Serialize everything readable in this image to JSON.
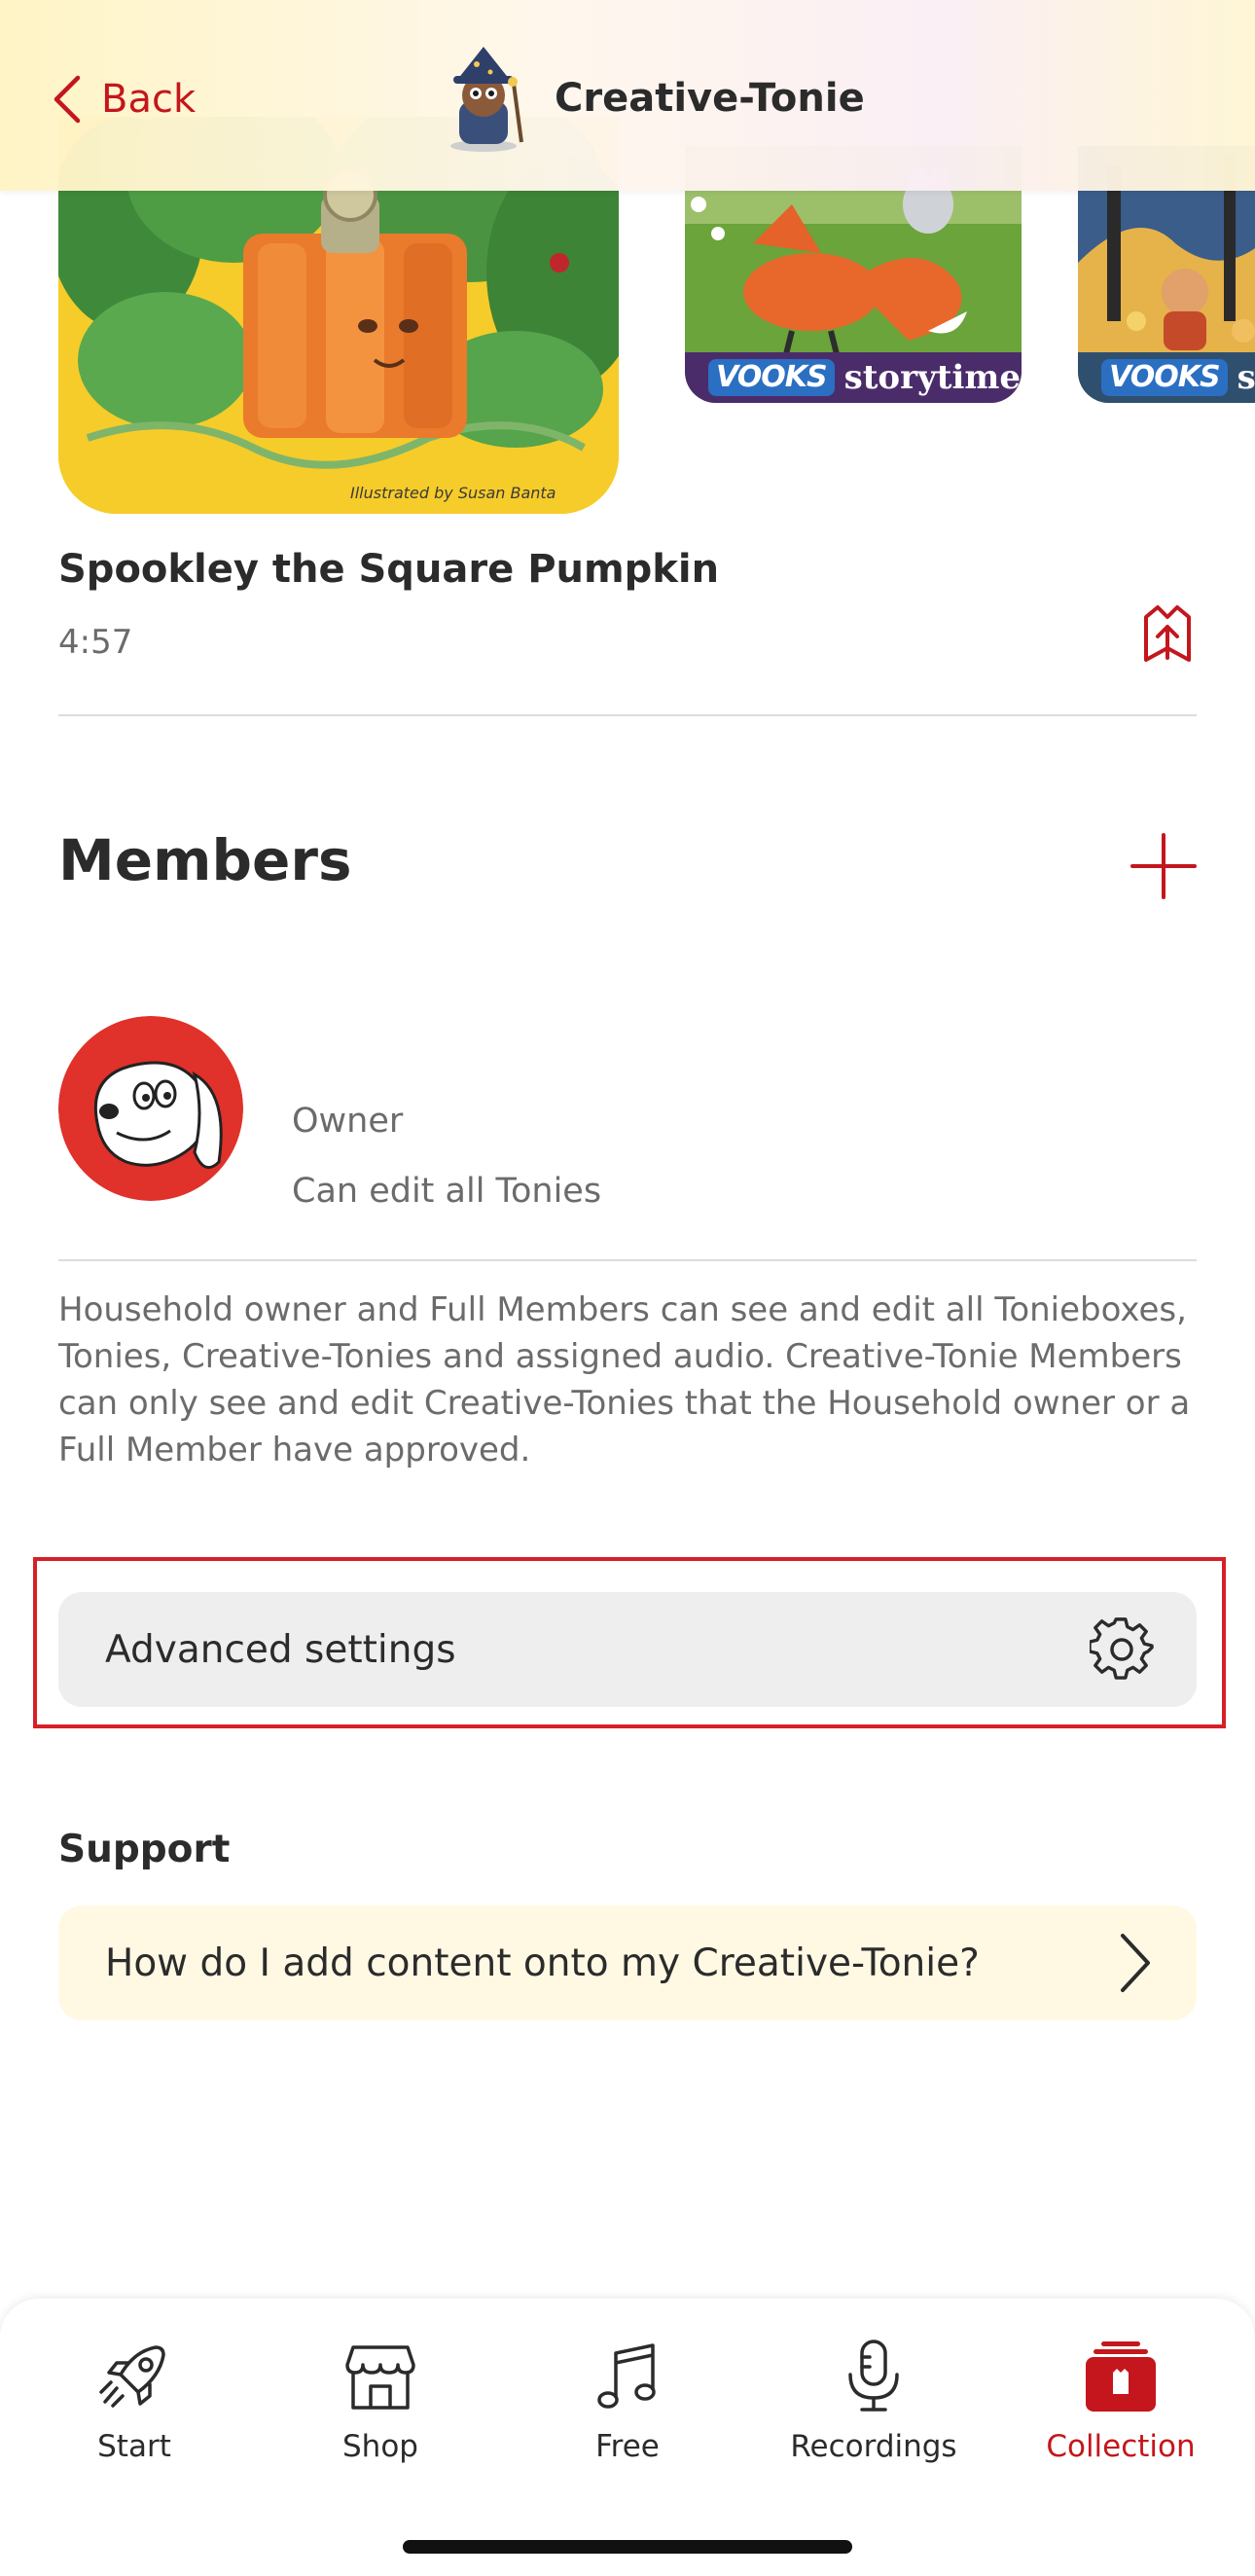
{
  "header": {
    "back_label": "Back",
    "title": "Creative-Tonie"
  },
  "carousel": {
    "main_cover_caption": "Illustrated by Susan Banta",
    "vooks_logo": "VOOKS",
    "vooks_text": "storytime",
    "vooks_text_partial": "sto"
  },
  "track": {
    "title": "Spookley the Square Pumpkin",
    "duration": "4:57"
  },
  "members": {
    "heading": "Members",
    "items": [
      {
        "role": "Owner",
        "permission": "Can edit all Tonies"
      }
    ],
    "info": "Household owner and Full Members can see and edit all Tonieboxes, Tonies, Creative-Tonies and assigned audio. Creative-Tonie Members can only see and edit Creative-Tonies that the Household owner or a Full Member have approved."
  },
  "advanced_settings": {
    "label": "Advanced settings"
  },
  "support": {
    "heading": "Support",
    "faq_label": "How do I add content onto my Creative-Tonie?"
  },
  "tabbar": {
    "tabs": [
      {
        "label": "Start",
        "icon": "rocket-icon"
      },
      {
        "label": "Shop",
        "icon": "store-icon"
      },
      {
        "label": "Free",
        "icon": "music-note-icon"
      },
      {
        "label": "Recordings",
        "icon": "microphone-icon"
      },
      {
        "label": "Collection",
        "icon": "collection-icon",
        "active": true
      }
    ]
  },
  "colors": {
    "accent": "#c4161c",
    "highlight_border": "#d62027",
    "settings_bg": "#eeeeee",
    "support_bg": "#fff9e4"
  }
}
